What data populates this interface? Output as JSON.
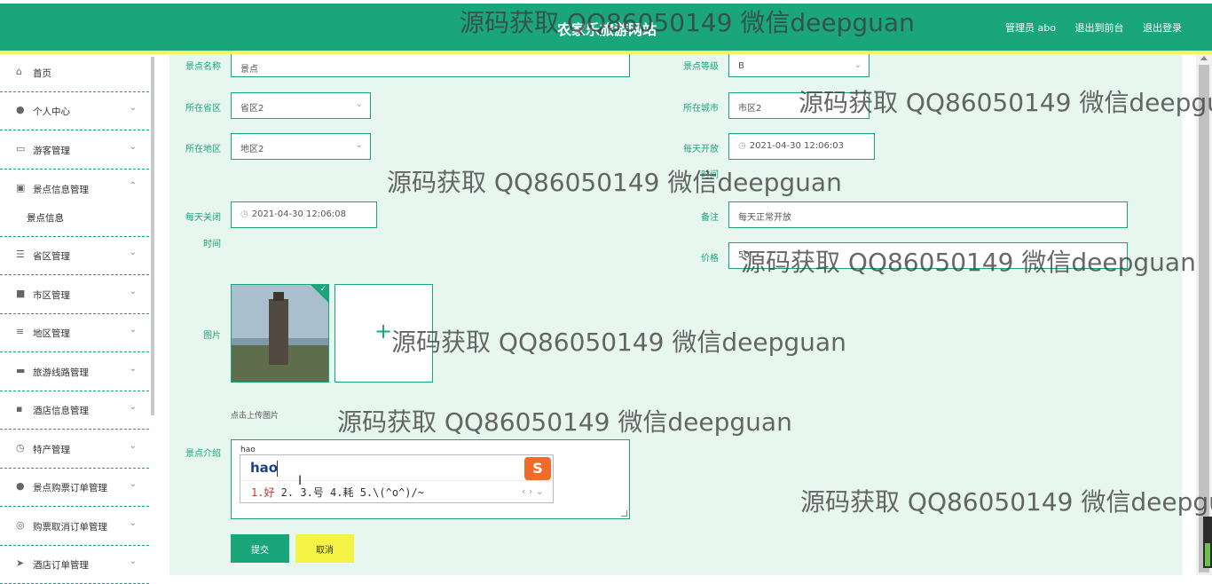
{
  "header": {
    "site_title": "农家乐旅游网站",
    "admin_label": "管理员 abo",
    "front_link": "退出到前台",
    "logout_link": "退出登录"
  },
  "sidebar": {
    "items": [
      {
        "label": "首页",
        "icon": "home-icon"
      },
      {
        "label": "个人中心",
        "icon": "user-icon"
      },
      {
        "label": "游客管理",
        "icon": "id-card-icon"
      },
      {
        "label": "景点信息管理",
        "icon": "tag-icon"
      },
      {
        "label": "省区管理",
        "icon": "list-icon"
      },
      {
        "label": "市区管理",
        "icon": "server-icon"
      },
      {
        "label": "地区管理",
        "icon": "sliders-icon"
      },
      {
        "label": "旅游线路管理",
        "icon": "ticket-icon"
      },
      {
        "label": "酒店信息管理",
        "icon": "chat-icon"
      },
      {
        "label": "特产管理",
        "icon": "clock-icon"
      },
      {
        "label": "景点购票订单管理",
        "icon": "user-icon"
      },
      {
        "label": "购票取消订单管理",
        "icon": "compass-icon"
      },
      {
        "label": "酒店订单管理",
        "icon": "send-icon"
      }
    ],
    "sub_item": "景点信息"
  },
  "form": {
    "name_label": "景点名称",
    "name_value": "景点",
    "level_label": "景点等级",
    "level_value": "B",
    "province_label": "所在省区",
    "province_value": "省区2",
    "city_label": "所在城市",
    "city_value": "市区2",
    "area_label": "所在地区",
    "area_value": "地区2",
    "open_label": "每天开放",
    "open_value": "2021-04-30 12:06:03",
    "open_label2": "时间",
    "close_label": "每天关闭",
    "close_label2": "时间",
    "close_value": "2021-04-30 12:06:08",
    "remark_label": "备注",
    "remark_value": "每天正常开放",
    "price_label": "价格",
    "price_value": "50",
    "image_label": "图片",
    "upload_hint": "点击上传图片",
    "intro_label": "景点介绍",
    "intro_value": "hao",
    "submit_label": "提交",
    "cancel_label": "取消"
  },
  "ime": {
    "pinyin": "hao",
    "candidates": "1.好  2.   3.号  4.耗  5.\\(^o^)/~",
    "first": "1.好"
  },
  "watermark": "源码获取 QQ86050149 微信deepguan"
}
